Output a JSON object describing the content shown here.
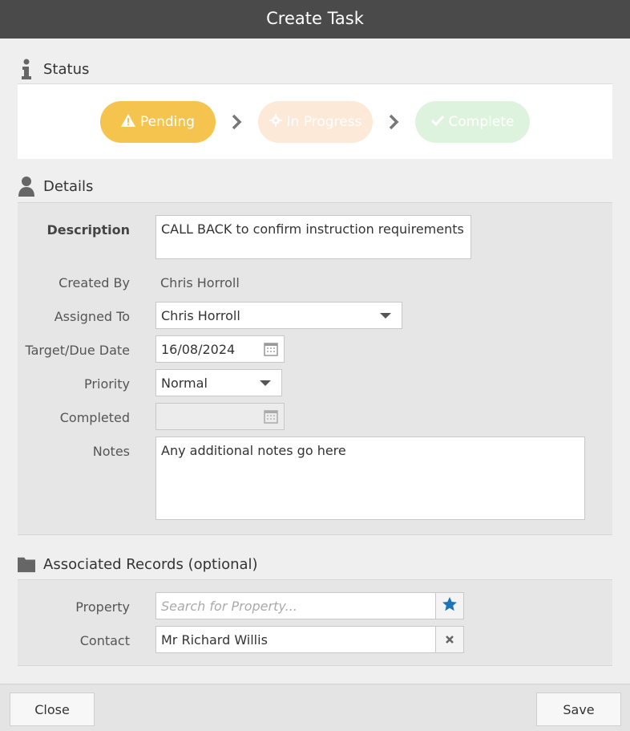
{
  "window": {
    "title": "Create Task"
  },
  "status": {
    "heading": "Status",
    "steps": [
      {
        "label": "Pending",
        "icon": "warning-icon",
        "color": "#f5c44e",
        "active": true
      },
      {
        "label": "In Progress",
        "icon": "gear-icon",
        "color": "#fde9d8",
        "active": false
      },
      {
        "label": "Complete",
        "icon": "check-icon",
        "color": "#def3dd",
        "active": false
      }
    ]
  },
  "details": {
    "heading": "Details",
    "description": {
      "label": "Description",
      "value": "CALL BACK to confirm instruction requirements"
    },
    "created_by": {
      "label": "Created By",
      "value": "Chris Horroll"
    },
    "assigned_to": {
      "label": "Assigned To",
      "value": "Chris Horroll"
    },
    "due_date": {
      "label": "Target/Due Date",
      "value": "16/08/2024"
    },
    "priority": {
      "label": "Priority",
      "value": "Normal"
    },
    "completed": {
      "label": "Completed",
      "value": ""
    },
    "notes": {
      "label": "Notes",
      "value": "Any additional notes go here"
    }
  },
  "associated": {
    "heading": "Associated Records (optional)",
    "property": {
      "label": "Property",
      "placeholder": "Search for Property..."
    },
    "contact": {
      "label": "Contact",
      "value": "Mr Richard Willis"
    }
  },
  "footer": {
    "close_label": "Close",
    "save_label": "Save"
  },
  "colors": {
    "titlebar": "#4a4a4a",
    "star": "#1b75bb",
    "pending": "#f5c44e"
  }
}
